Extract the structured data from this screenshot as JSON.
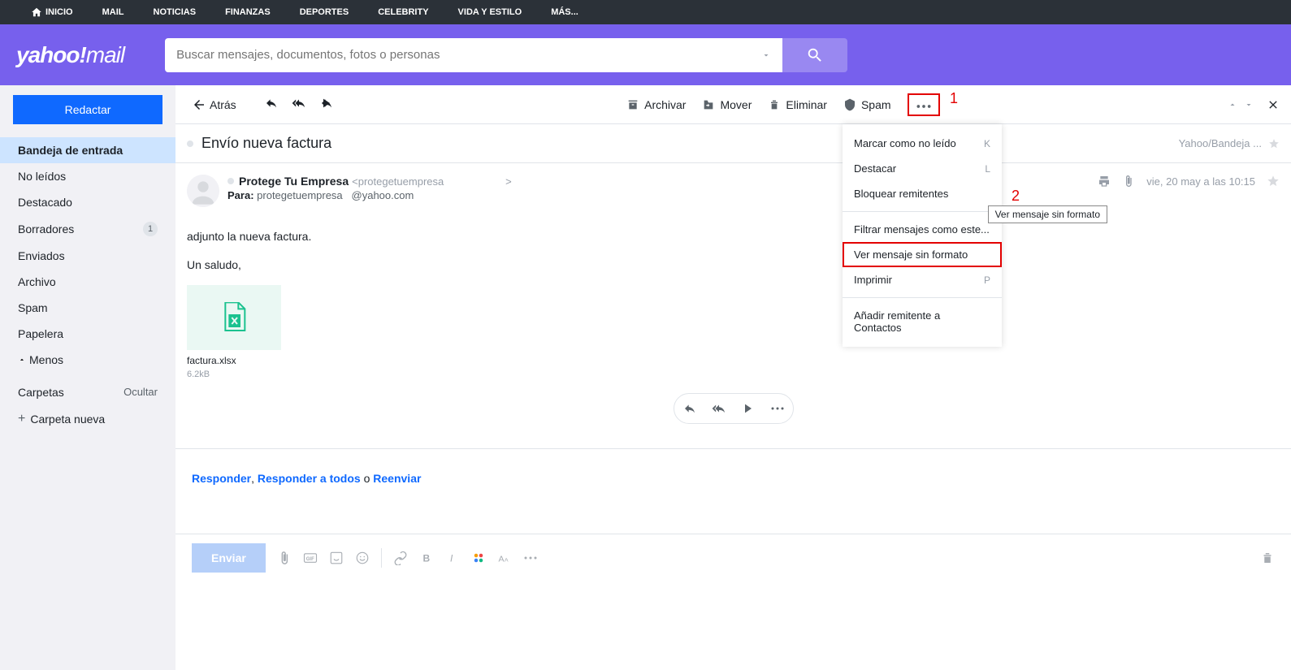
{
  "topnav": {
    "items": [
      {
        "label": "INICIO",
        "icon": true
      },
      {
        "label": "MAIL",
        "active": true
      },
      {
        "label": "NOTICIAS"
      },
      {
        "label": "FINANZAS"
      },
      {
        "label": "DEPORTES"
      },
      {
        "label": "CELEBRITY"
      },
      {
        "label": "VIDA Y ESTILO"
      },
      {
        "label": "MÁS..."
      }
    ]
  },
  "header": {
    "logo_main": "yahoo!",
    "logo_sub": "mail",
    "search_placeholder": "Buscar mensajes, documentos, fotos o personas"
  },
  "sidebar": {
    "compose": "Redactar",
    "folders": [
      {
        "label": "Bandeja de entrada",
        "active": true
      },
      {
        "label": "No leídos"
      },
      {
        "label": "Destacado"
      },
      {
        "label": "Borradores",
        "badge": "1"
      },
      {
        "label": "Enviados"
      },
      {
        "label": "Archivo"
      },
      {
        "label": "Spam"
      },
      {
        "label": "Papelera"
      }
    ],
    "less": "Menos",
    "section_folders": "Carpetas",
    "hide": "Ocultar",
    "new_folder": "Carpeta nueva"
  },
  "toolbar": {
    "back": "Atrás",
    "archive": "Archivar",
    "move": "Mover",
    "delete": "Eliminar",
    "spam": "Spam"
  },
  "message": {
    "subject": "Envío nueva factura",
    "folder_path": "Yahoo/Bandeja ...",
    "sender_name": "Protege Tu Empresa",
    "sender_email_prefix": "<protegetuempresa",
    "sender_email_suffix": ">",
    "to_label": "Para:",
    "to_name": "protegetuempresa",
    "to_domain": "@yahoo.com",
    "date": "vie, 20 may a las 10:15",
    "body_line1": "adjunto la nueva factura.",
    "body_line2": "Un saludo,",
    "attachment_name": "factura.xlsx",
    "attachment_size": "6.2kB"
  },
  "reply": {
    "reply": "Responder",
    "reply_all": "Responder a todos",
    "or": " o ",
    "forward": "Reenviar",
    "comma": ", "
  },
  "compose_bar": {
    "send": "Enviar"
  },
  "dropdown": {
    "items": [
      {
        "label": "Marcar como no leído",
        "key": "K"
      },
      {
        "label": "Destacar",
        "key": "L"
      },
      {
        "label": "Bloquear remitentes"
      },
      {
        "sep": true
      },
      {
        "label": "Filtrar mensajes como este..."
      },
      {
        "label": "Ver mensaje sin formato",
        "highlighted": true
      },
      {
        "label": "Imprimir",
        "key": "P"
      },
      {
        "sep": true
      },
      {
        "label": "Añadir remitente a Contactos"
      }
    ]
  },
  "tooltip": "Ver mensaje sin formato",
  "callouts": {
    "one": "1",
    "two": "2"
  }
}
